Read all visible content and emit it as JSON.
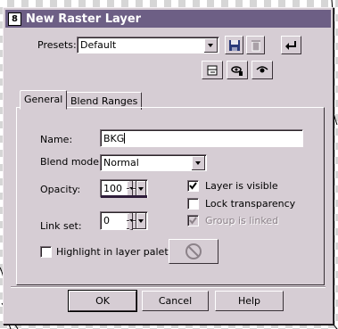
{
  "window": {
    "title": "New Raster Layer",
    "icon": "app-icon"
  },
  "presets": {
    "label": "Presets:",
    "value": "Default"
  },
  "toolbar": {
    "save": "save-icon",
    "delete": "delete-icon",
    "reset": "reset-icon"
  },
  "tabs": [
    {
      "label": "General",
      "active": true
    },
    {
      "label": "Blend Ranges",
      "active": false
    }
  ],
  "general": {
    "name_label": "Name:",
    "name_value": "BKG",
    "blend_label": "Blend mode:",
    "blend_value": "Normal",
    "opacity_label": "Opacity:",
    "opacity_value": "100",
    "linkset_label": "Link set:",
    "linkset_value": "0",
    "layer_visible_label": "Layer is visible",
    "layer_visible_checked": true,
    "lock_transparency_label": "Lock transparency",
    "lock_transparency_checked": false,
    "group_linked_label": "Group is linked",
    "group_linked_checked": true,
    "highlight_label": "Highlight in layer palette:",
    "highlight_checked": false
  },
  "buttons": {
    "ok": "OK",
    "cancel": "Cancel",
    "help": "Help"
  },
  "colors": {
    "titlebar": "#6d5f85",
    "dialog": "#d6cdd4"
  }
}
